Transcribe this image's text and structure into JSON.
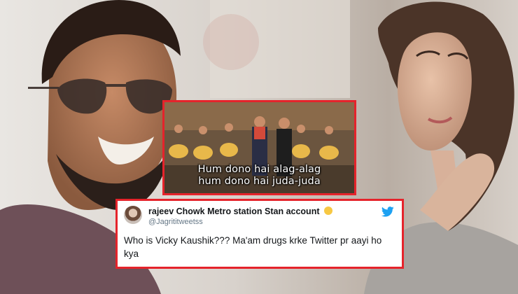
{
  "meme": {
    "caption_line1": "Hum dono hai alag-alag",
    "caption_line2": "hum dono hai juda-juda"
  },
  "tweet": {
    "display_name": "rajeev Chowk Metro station Stan account",
    "handle": "@Jagrititweetss",
    "text": "Who is Vicky Kaushik??? Ma'am drugs krke Twitter pr aayi ho kya",
    "emoji_icon": "relieved-face-icon",
    "platform_icon": "twitter-bird-icon"
  },
  "colors": {
    "frame_red": "#e5232b",
    "twitter_blue": "#1da1f2"
  }
}
